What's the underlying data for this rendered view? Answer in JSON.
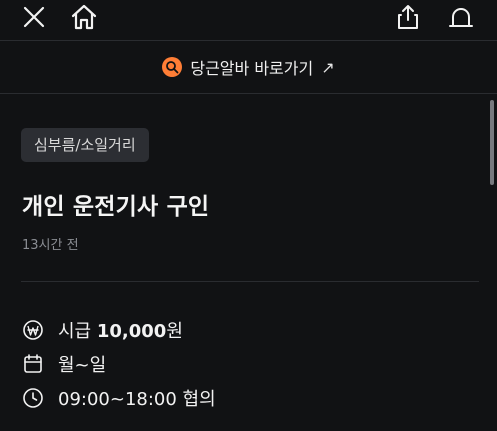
{
  "topbar": {
    "close_icon": "close-icon",
    "home_icon": "home-icon",
    "share_icon": "share-icon",
    "alarm_icon": "alarm-icon"
  },
  "banner": {
    "logo_icon": "daangn-alba-logo-icon",
    "text": "당근알바 바로가기",
    "arrow": "↗",
    "accent_color": "#ff7e36"
  },
  "post": {
    "category": "심부름/소일거리",
    "title": "개인 운전기사 구인",
    "time_ago": "13시간 전"
  },
  "details": {
    "wage_label": "시급",
    "wage_amount": "10,000",
    "wage_unit": "원",
    "days": "월~일",
    "hours": "09:00~18:00 협의"
  }
}
